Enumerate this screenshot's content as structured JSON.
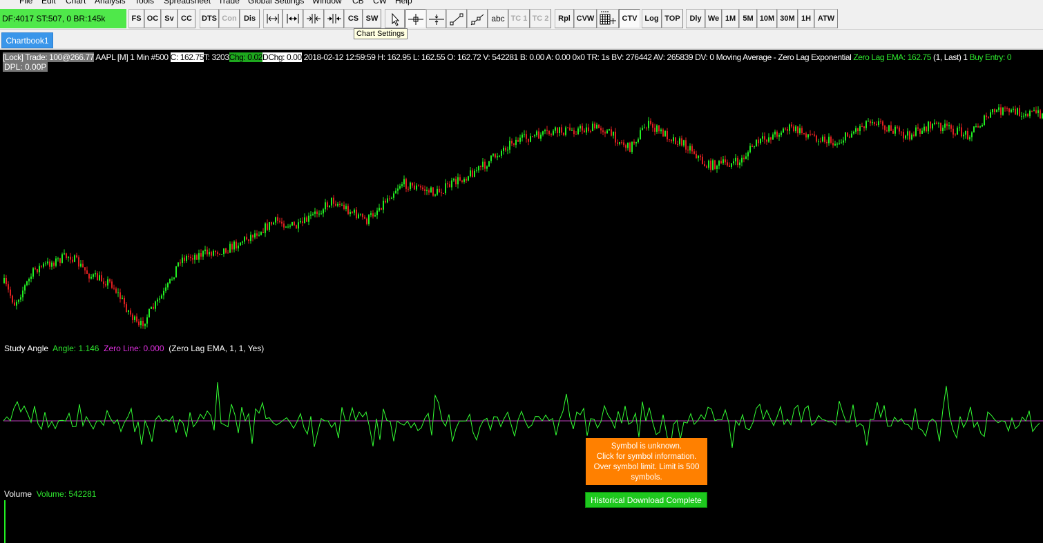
{
  "menu": [
    "File",
    "Edit",
    "Chart",
    "Analysis",
    "Tools",
    "Spreadsheet",
    "Trade",
    "Global Settings",
    "Window",
    "CB",
    "CW",
    "Help"
  ],
  "status": "DF:4017  ST:507, 0  BR:145k",
  "buttons": {
    "fs": "FS",
    "oc": "OC",
    "sv": "Sv",
    "cc": "CC",
    "dts": "DTS",
    "con": "Con",
    "dis": "Dis",
    "cs": "CS",
    "sw": "SW",
    "abc": "abc",
    "tc1": "TC 1",
    "tc2": "TC 2",
    "rpl": "Rpl",
    "cvw": "CVW",
    "ctv": "CTV",
    "log": "Log",
    "top": "TOP",
    "dly": "Dly",
    "we": "We",
    "m1": "1M",
    "m5": "5M",
    "m10": "10M",
    "m30": "30M",
    "h1": "1H",
    "atw": "ATW"
  },
  "tooltip": "Chart Settings",
  "tab": "Chartbook1",
  "info": {
    "lock": "[Lock] Trade: 100@266.77",
    "symbol": "AAPL [M]  1 Min   #500",
    "close": "C: 162.75",
    "trades": "T: 3203",
    "chg": "Chg: 0.02",
    "dchg": "DChg: 0.00",
    "rest": "2018-02-12 12:59:59 H: 162.95 L: 162.55 O: 162.72 V: 542281 B: 0.00 A: 0.00 0x0 TR: 1s BV: 276442 AV: 265839 DV: 0 Moving Average - Zero Lag Exponential",
    "ema": "Zero Lag EMA: 162.75",
    "params": "(1, Last)  1",
    "buy": "Buy Entry: 0",
    "dpl": "DPL: 0.00P"
  },
  "study": {
    "name": "Study Angle",
    "angle": "Angle: 1.146",
    "zero": "Zero Line: 0.000",
    "params": "(Zero Lag EMA, 1, 1, Yes)"
  },
  "volume": {
    "name": "Volume",
    "value": "Volume: 542281"
  },
  "popup": {
    "line1": "Symbol is unknown.",
    "line2": "Click for symbol information.",
    "line3": "Over symbol limit.  Limit is 500",
    "line4": "symbols."
  },
  "download": "Historical Download Complete",
  "colors": {
    "up": "#22ee22",
    "down": "#e02020",
    "angle": "#33ff33",
    "zero": "#c040c0",
    "status": "#4fe84a",
    "popup": "#ff8000"
  }
}
